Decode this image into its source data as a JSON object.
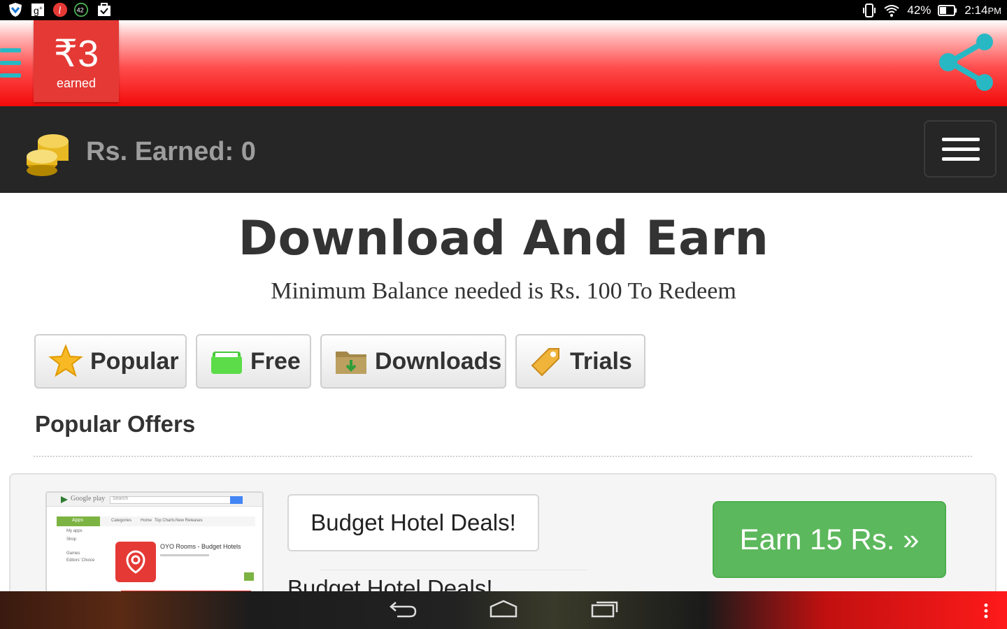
{
  "status_bar": {
    "notification_icons": [
      "shield-icon",
      "google-plus-icon",
      "app-i-icon",
      "badge-42-icon",
      "briefcase-check-icon"
    ],
    "badge_count": "42",
    "battery": "42%",
    "time": "2:14",
    "ampm": "PM"
  },
  "header": {
    "earned_amount": "₹3",
    "earned_label": "earned",
    "colors": {
      "accent": "#e53935",
      "share": "#28b8c4"
    }
  },
  "navbar": {
    "brand": "Rs. Earned: 0"
  },
  "main": {
    "headline": "Download And Earn",
    "subline": "Minimum Balance needed is Rs. 100 To Redeem",
    "tabs": [
      {
        "label": "Popular",
        "icon": "star-icon"
      },
      {
        "label": "Free",
        "icon": "green-folder-icon"
      },
      {
        "label": "Downloads",
        "icon": "download-folder-icon"
      },
      {
        "label": "Trials",
        "icon": "tag-icon"
      }
    ],
    "section_title": "Popular Offers",
    "offer": {
      "thumb": {
        "store": "Google play",
        "search": "Search",
        "app_name": "OYO Rooms - Budget Hotels",
        "sidebar": [
          "Apps",
          "My apps",
          "Shop",
          "Games",
          "Editors' Choice"
        ],
        "menu": [
          "Categories",
          "Home",
          "Top Charts",
          "New Releases"
        ]
      },
      "title": "Budget Hotel Deals!",
      "subtitle": "Budget Hotel Deals!",
      "button": "Earn 15 Rs. »",
      "button_color": "#5cb85c"
    }
  }
}
